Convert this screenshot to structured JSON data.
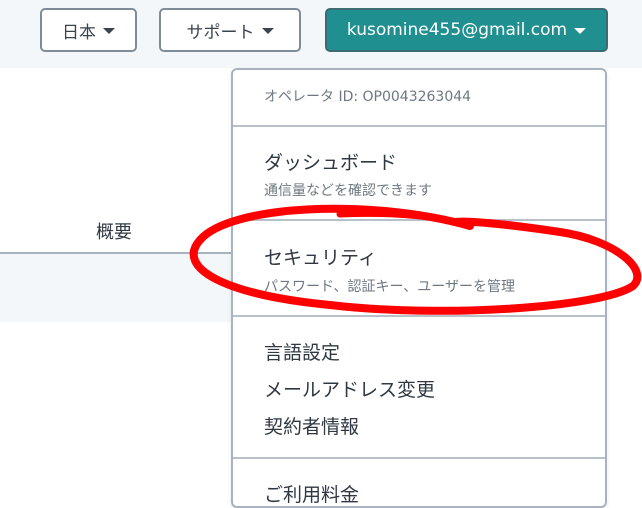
{
  "topbar": {
    "language_label": "日本",
    "support_label": "サポート",
    "account_label": "kusomine455@gmail.com"
  },
  "page": {
    "tab_overview": "概要"
  },
  "dropdown": {
    "operator_label": "オペレータ ID: OP0043263044",
    "items": [
      {
        "title": "ダッシュボード",
        "subtitle": "通信量などを確認できます"
      },
      {
        "title": "セキュリティ",
        "subtitle": "パスワード、認証キー、ユーザーを管理"
      }
    ],
    "links": [
      "言語設定",
      "メールアドレス変更",
      "契約者情報"
    ],
    "partial_item": "ご利用料金"
  },
  "colors": {
    "accent": "#1f8f8f",
    "annotation": "#ff0000"
  },
  "icons": {
    "caret": "caret-down-icon"
  }
}
